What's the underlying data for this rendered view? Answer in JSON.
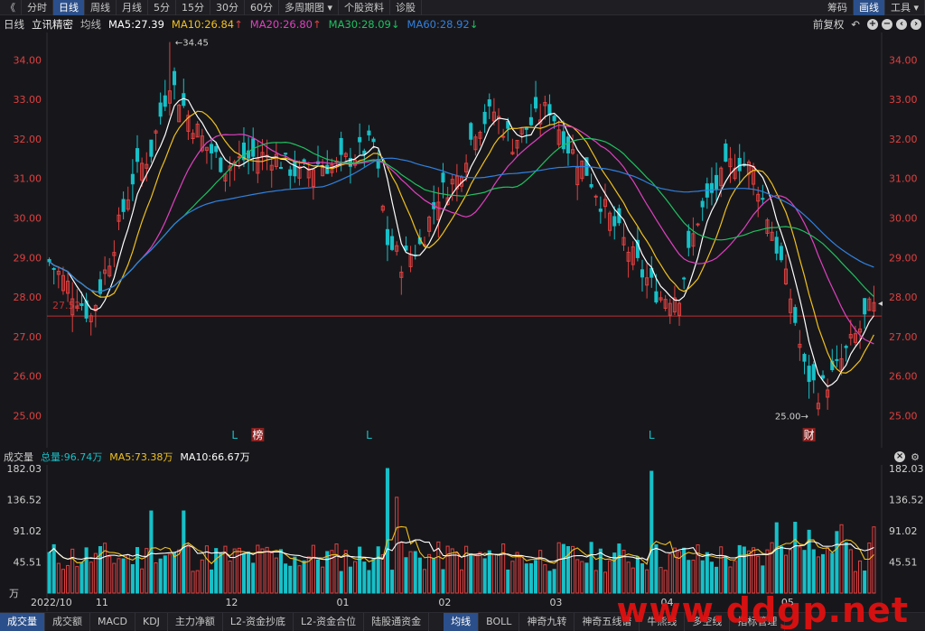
{
  "toolbar": {
    "collapse": "《",
    "items": [
      "分时",
      "日线",
      "周线",
      "月线",
      "5分",
      "15分",
      "30分",
      "60分",
      "多周期图",
      "个股资料",
      "诊股"
    ],
    "active": "日线",
    "right": [
      "筹码",
      "画线",
      "工具"
    ]
  },
  "info": {
    "period": "日线",
    "stock": "立讯精密",
    "ma_label": "均线",
    "ma5": "MA5:27.39",
    "ma10": "MA10:26.84",
    "ma20": "MA20:26.80",
    "ma30": "MA30:28.09",
    "ma60": "MA60:28.92",
    "adjust": "前复权"
  },
  "colors": {
    "up": "#e04040",
    "down": "#17c0c8",
    "ma5": "#ffffff",
    "ma10": "#f0c020",
    "ma20": "#e040c0",
    "ma30": "#20c060",
    "ma60": "#3080e0",
    "price_label": "#e04040",
    "accent": "#2b4f8a"
  },
  "price_axis": {
    "ticks": [
      "34.00",
      "33.00",
      "32.00",
      "31.00",
      "30.00",
      "29.00",
      "28.00",
      "27.00",
      "26.00",
      "25.00"
    ]
  },
  "annotations": {
    "high": "34.45",
    "low": "25.00",
    "hline": "27.52"
  },
  "markers": [
    {
      "text": "L"
    },
    {
      "text": "榜"
    },
    {
      "text": "L"
    },
    {
      "text": "L"
    },
    {
      "text": "财"
    }
  ],
  "volume": {
    "title": "成交量",
    "total": "总量:96.74万",
    "ma5": "MA5:73.38万",
    "ma10": "MA10:66.67万",
    "ticks": [
      "182.03",
      "136.52",
      "91.02",
      "45.51"
    ],
    "unit": "万"
  },
  "dates": [
    "2022/10",
    "11",
    "12",
    "01",
    "02",
    "03",
    "04",
    "05"
  ],
  "bottom": {
    "left": [
      "成交量",
      "成交额",
      "MACD",
      "KDJ",
      "主力净额",
      "L2-资金抄底",
      "L2-资金合位",
      "陆股通资金"
    ],
    "active_left": "成交量",
    "right": [
      "均线",
      "BOLL",
      "神奇九转",
      "神奇五线谱",
      "牛熊线",
      "多空线",
      "指标管理"
    ],
    "active_right": "均线"
  },
  "watermark": "www.ddgp.net",
  "chart_data": {
    "type": "candlestick",
    "series": [
      {
        "name": "MA5"
      },
      {
        "name": "MA10"
      },
      {
        "name": "MA20"
      },
      {
        "name": "MA30"
      },
      {
        "name": "MA60"
      }
    ],
    "ylim": [
      24.6,
      34.6
    ],
    "last_close": 27.86
  }
}
